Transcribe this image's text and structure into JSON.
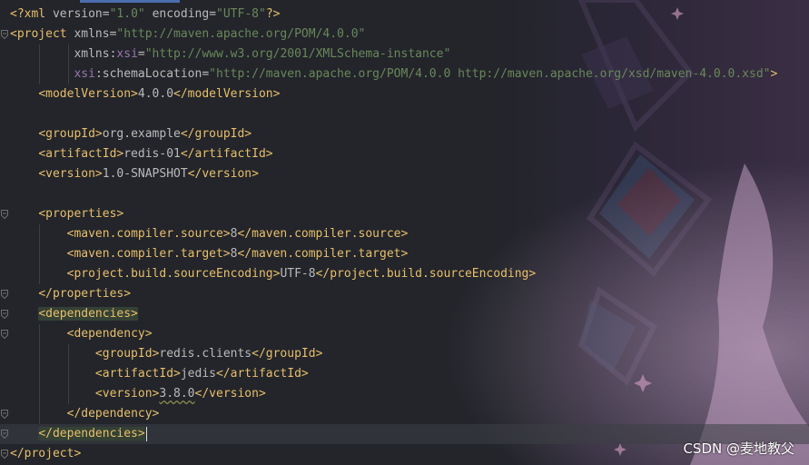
{
  "editor": {
    "lines": [
      {
        "segments": [
          {
            "t": "tag",
            "v": "<?xml "
          },
          {
            "t": "attr",
            "v": "version"
          },
          {
            "t": "txt",
            "v": "="
          },
          {
            "t": "val",
            "v": "\"1.0\""
          },
          {
            "t": "txt",
            "v": " "
          },
          {
            "t": "attr",
            "v": "encoding"
          },
          {
            "t": "txt",
            "v": "="
          },
          {
            "t": "val",
            "v": "\"UTF-8\""
          },
          {
            "t": "tag",
            "v": "?>"
          }
        ]
      },
      {
        "segments": [
          {
            "t": "tag",
            "v": "<project "
          },
          {
            "t": "attr",
            "v": "xmlns"
          },
          {
            "t": "txt",
            "v": "="
          },
          {
            "t": "val",
            "v": "\"http://maven.apache.org/POM/4.0.0\""
          }
        ]
      },
      {
        "segments": [
          {
            "t": "txt",
            "v": "         "
          },
          {
            "t": "attr",
            "v": "xmlns"
          },
          {
            "t": "txt",
            "v": ":"
          },
          {
            "t": "ns",
            "v": "xsi"
          },
          {
            "t": "txt",
            "v": "="
          },
          {
            "t": "val",
            "v": "\"http://www.w3.org/2001/XMLSchema-instance\""
          }
        ]
      },
      {
        "segments": [
          {
            "t": "txt",
            "v": "         "
          },
          {
            "t": "ns",
            "v": "xsi"
          },
          {
            "t": "txt",
            "v": ":"
          },
          {
            "t": "attr",
            "v": "schemaLocation"
          },
          {
            "t": "txt",
            "v": "="
          },
          {
            "t": "val",
            "v": "\"http://maven.apache.org/POM/4.0.0 http://maven.apache.org/xsd/maven-4.0.0.xsd\""
          },
          {
            "t": "tag",
            "v": ">"
          }
        ]
      },
      {
        "segments": [
          {
            "t": "txt",
            "v": "    "
          },
          {
            "t": "tag",
            "v": "<modelVersion>"
          },
          {
            "t": "txt",
            "v": "4.0.0"
          },
          {
            "t": "tag",
            "v": "</modelVersion>"
          }
        ]
      },
      {
        "segments": []
      },
      {
        "segments": [
          {
            "t": "txt",
            "v": "    "
          },
          {
            "t": "tag",
            "v": "<groupId>"
          },
          {
            "t": "txt",
            "v": "org.example"
          },
          {
            "t": "tag",
            "v": "</groupId>"
          }
        ]
      },
      {
        "segments": [
          {
            "t": "txt",
            "v": "    "
          },
          {
            "t": "tag",
            "v": "<artifactId>"
          },
          {
            "t": "txt",
            "v": "redis-01"
          },
          {
            "t": "tag",
            "v": "</artifactId>"
          }
        ]
      },
      {
        "segments": [
          {
            "t": "txt",
            "v": "    "
          },
          {
            "t": "tag",
            "v": "<version>"
          },
          {
            "t": "txt",
            "v": "1.0-SNAPSHOT"
          },
          {
            "t": "tag",
            "v": "</version>"
          }
        ]
      },
      {
        "segments": []
      },
      {
        "segments": [
          {
            "t": "txt",
            "v": "    "
          },
          {
            "t": "tag",
            "v": "<properties>"
          }
        ]
      },
      {
        "segments": [
          {
            "t": "txt",
            "v": "        "
          },
          {
            "t": "tag",
            "v": "<maven.compiler.source>"
          },
          {
            "t": "txt",
            "v": "8"
          },
          {
            "t": "tag",
            "v": "</maven.compiler.source>"
          }
        ]
      },
      {
        "segments": [
          {
            "t": "txt",
            "v": "        "
          },
          {
            "t": "tag",
            "v": "<maven.compiler.target>"
          },
          {
            "t": "txt",
            "v": "8"
          },
          {
            "t": "tag",
            "v": "</maven.compiler.target>"
          }
        ]
      },
      {
        "segments": [
          {
            "t": "txt",
            "v": "        "
          },
          {
            "t": "tag",
            "v": "<project.build.sourceEncoding>"
          },
          {
            "t": "txt",
            "v": "UTF-8"
          },
          {
            "t": "tag",
            "v": "</project.build.sourceEncoding>"
          }
        ]
      },
      {
        "segments": [
          {
            "t": "txt",
            "v": "    "
          },
          {
            "t": "tag",
            "v": "</properties>"
          }
        ]
      },
      {
        "segments": [
          {
            "t": "txt",
            "v": "    "
          },
          {
            "t": "taghl",
            "v": "<dependencies>"
          }
        ]
      },
      {
        "segments": [
          {
            "t": "txt",
            "v": "        "
          },
          {
            "t": "tag",
            "v": "<dependency>"
          }
        ]
      },
      {
        "segments": [
          {
            "t": "txt",
            "v": "            "
          },
          {
            "t": "tag",
            "v": "<groupId>"
          },
          {
            "t": "txt",
            "v": "redis.clients"
          },
          {
            "t": "tag",
            "v": "</groupId>"
          }
        ]
      },
      {
        "segments": [
          {
            "t": "txt",
            "v": "            "
          },
          {
            "t": "tag",
            "v": "<artifactId>"
          },
          {
            "t": "txt",
            "v": "jedis"
          },
          {
            "t": "tag",
            "v": "</artifactId>"
          }
        ]
      },
      {
        "segments": [
          {
            "t": "txt",
            "v": "            "
          },
          {
            "t": "tag",
            "v": "<version>"
          },
          {
            "t": "squig",
            "v": "3.8.0"
          },
          {
            "t": "tag",
            "v": "</version>"
          }
        ]
      },
      {
        "segments": [
          {
            "t": "txt",
            "v": "        "
          },
          {
            "t": "tag",
            "v": "</dependency>"
          }
        ]
      },
      {
        "segments": [
          {
            "t": "txt",
            "v": "    "
          },
          {
            "t": "taghl",
            "v": "</dependencies>"
          },
          {
            "t": "caret",
            "v": ""
          }
        ]
      },
      {
        "segments": [
          {
            "t": "tag",
            "v": "</project>"
          }
        ]
      }
    ],
    "current_line": 21,
    "fold_markers": [
      1,
      10,
      14,
      15,
      16,
      20,
      21,
      22
    ]
  },
  "watermark": "CSDN @麦地教父",
  "colors": {
    "tag": "#e8bf6a",
    "value": "#6a8759",
    "namespace": "#9876aa",
    "text": "#bababa",
    "background": "#23252b",
    "accent": "#4b6eaf"
  }
}
